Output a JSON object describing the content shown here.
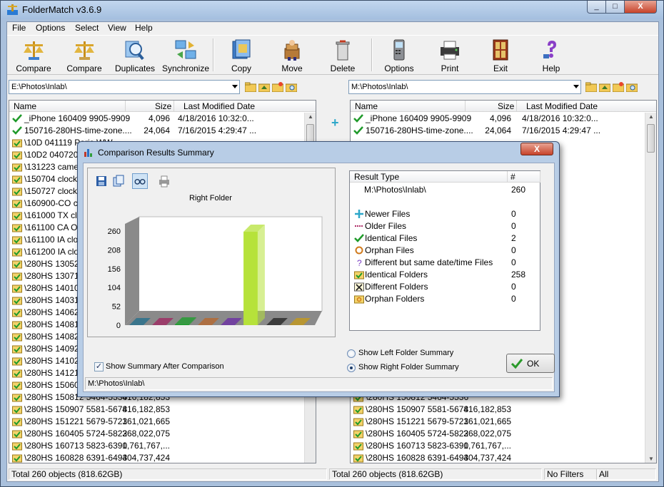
{
  "window": {
    "title": "FolderMatch v3.6.9",
    "min": "_",
    "max": "□",
    "close": "X"
  },
  "menu": [
    "File",
    "Options",
    "Select",
    "View",
    "Help"
  ],
  "toolbar": [
    {
      "label": "Compare",
      "icon": "compare-icon"
    },
    {
      "label": "Compare",
      "icon": "compare-scales-icon"
    },
    {
      "label": "Duplicates",
      "icon": "duplicates-icon"
    },
    {
      "label": "Synchronize",
      "icon": "synchronize-icon"
    },
    {
      "label": "Copy",
      "icon": "copy-icon"
    },
    {
      "label": "Move",
      "icon": "move-icon"
    },
    {
      "label": "Delete",
      "icon": "delete-icon"
    },
    {
      "label": "Options",
      "icon": "options-icon"
    },
    {
      "label": "Print",
      "icon": "print-icon"
    },
    {
      "label": "Exit",
      "icon": "exit-icon"
    },
    {
      "label": "Help",
      "icon": "help-icon"
    }
  ],
  "left": {
    "path": "E:\\Photos\\Inlab\\",
    "columns": [
      "Name",
      "Size",
      "Last Modified Date"
    ],
    "rows": [
      {
        "icon": "check",
        "name": "_iPhone 160409 9905-9909",
        "size": "4,096",
        "date": "4/18/2016 10:32:0..."
      },
      {
        "icon": "check",
        "name": "150716-280HS-time-zone....",
        "size": "24,064",
        "date": "7/16/2015 4:29:47 ..."
      },
      {
        "icon": "folder",
        "name": "\\10D 041119 Paris WW...",
        "size": "",
        "date": ""
      },
      {
        "icon": "folder",
        "name": "\\10D2 040720",
        "size": "",
        "date": ""
      },
      {
        "icon": "folder",
        "name": "\\131223 camera",
        "size": "",
        "date": ""
      },
      {
        "icon": "folder",
        "name": "\\150704 clock",
        "size": "",
        "date": ""
      },
      {
        "icon": "folder",
        "name": "\\150727 clock",
        "size": "",
        "date": ""
      },
      {
        "icon": "folder",
        "name": "\\160900-CO clock",
        "size": "",
        "date": ""
      },
      {
        "icon": "folder",
        "name": "\\161000 TX clock",
        "size": "",
        "date": ""
      },
      {
        "icon": "folder",
        "name": "\\161100 CA OH",
        "size": "",
        "date": ""
      },
      {
        "icon": "folder",
        "name": "\\161100 IA clock",
        "size": "",
        "date": ""
      },
      {
        "icon": "folder",
        "name": "\\161200 IA clock",
        "size": "",
        "date": ""
      },
      {
        "icon": "folder",
        "name": "\\280HS 130520",
        "size": "",
        "date": ""
      },
      {
        "icon": "folder",
        "name": "\\280HS 130712",
        "size": "",
        "date": ""
      },
      {
        "icon": "folder",
        "name": "\\280HS 140102",
        "size": "",
        "date": ""
      },
      {
        "icon": "folder",
        "name": "\\280HS 140317",
        "size": "",
        "date": ""
      },
      {
        "icon": "folder",
        "name": "\\280HS 140625",
        "size": "",
        "date": ""
      },
      {
        "icon": "folder",
        "name": "\\280HS 140814",
        "size": "",
        "date": ""
      },
      {
        "icon": "folder",
        "name": "\\280HS 140827",
        "size": "",
        "date": ""
      },
      {
        "icon": "folder",
        "name": "\\280HS 140925",
        "size": "",
        "date": ""
      },
      {
        "icon": "folder",
        "name": "\\280HS 141023",
        "size": "",
        "date": ""
      },
      {
        "icon": "folder",
        "name": "\\280HS 141210",
        "size": "",
        "date": ""
      },
      {
        "icon": "folder",
        "name": "\\280HS 150601",
        "size": "",
        "date": ""
      },
      {
        "icon": "folder",
        "name": "\\280HS 150812 5464-5536",
        "size": "416,182,853",
        "date": ""
      },
      {
        "icon": "folder",
        "name": "\\280HS 150907 5581-5678",
        "size": "416,182,853",
        "date": ""
      },
      {
        "icon": "folder",
        "name": "\\280HS 151221 5679-5723",
        "size": "161,021,665",
        "date": ""
      },
      {
        "icon": "folder",
        "name": "\\280HS 160405 5724-5822",
        "size": "368,022,075",
        "date": ""
      },
      {
        "icon": "folder",
        "name": "\\280HS 160713 5823-6390",
        "size": "1,761,767,...",
        "date": ""
      },
      {
        "icon": "folder",
        "name": "\\280HS 160828 6391-6493",
        "size": "404,737,424",
        "date": ""
      }
    ]
  },
  "right": {
    "path": "M:\\Photos\\Inlab\\",
    "columns": [
      "Name",
      "Size",
      "Last Modified Date"
    ],
    "rows": [
      {
        "icon": "check",
        "name": "_iPhone 160409 9905-9909",
        "size": "4,096",
        "date": "4/18/2016 10:32:0..."
      },
      {
        "icon": "check",
        "name": "150716-280HS-time-zone....",
        "size": "24,064",
        "date": "7/16/2015 4:29:47 ..."
      },
      {
        "icon": "folder",
        "name": "\\280HS 150812 5464-5536",
        "size": "",
        "date": ""
      },
      {
        "icon": "folder",
        "name": "\\280HS 150907 5581-5678",
        "size": "416,182,853",
        "date": ""
      },
      {
        "icon": "folder",
        "name": "\\280HS 151221 5679-5723",
        "size": "161,021,665",
        "date": ""
      },
      {
        "icon": "folder",
        "name": "\\280HS 160405 5724-5822",
        "size": "368,022,075",
        "date": ""
      },
      {
        "icon": "folder",
        "name": "\\280HS 160713 5823-6390",
        "size": "1,761,767,...",
        "date": ""
      },
      {
        "icon": "folder",
        "name": "\\280HS 160828 6391-6493",
        "size": "404,737,424",
        "date": ""
      }
    ]
  },
  "status": {
    "left": "Total 260 objects  (818.62GB)",
    "right": "Total 260 objects  (818.62GB)",
    "filters": "No Filters",
    "all": "All"
  },
  "dialog": {
    "title": "Comparison Results Summary",
    "close": "X",
    "chart_title": "Right Folder",
    "results_header": [
      "Result Type",
      "#"
    ],
    "results": [
      {
        "icon": "none",
        "label": "M:\\Photos\\Inlab\\",
        "value": "260"
      },
      {
        "icon": "none",
        "label": "",
        "value": ""
      },
      {
        "icon": "plus",
        "label": "Newer Files",
        "value": "0"
      },
      {
        "icon": "minus",
        "label": "Older Files",
        "value": "0"
      },
      {
        "icon": "check",
        "label": "Identical Files",
        "value": "2"
      },
      {
        "icon": "orphan",
        "label": "Orphan Files",
        "value": "0"
      },
      {
        "icon": "question",
        "label": "Different but same date/time Files",
        "value": "0"
      },
      {
        "icon": "folder-check",
        "label": "Identical Folders",
        "value": "258"
      },
      {
        "icon": "folder-x",
        "label": "Different Folders",
        "value": "0"
      },
      {
        "icon": "folder-orphan",
        "label": "Orphan Folders",
        "value": "0"
      }
    ],
    "radio_left": "Show Left Folder Summary",
    "radio_right": "Show Right Folder Summary",
    "checkbox": "Show Summary After Comparison",
    "ok": "OK",
    "status_path": "M:\\Photos\\Inlab\\"
  },
  "chart_data": {
    "type": "bar",
    "title": "Right Folder",
    "categories": [
      "Newer Files",
      "Older Files",
      "Identical Files",
      "Orphan Files",
      "Different but same date/time Files",
      "Identical Folders",
      "Different Folders",
      "Orphan Folders"
    ],
    "values": [
      0,
      0,
      2,
      0,
      0,
      258,
      0,
      0
    ],
    "colors": [
      "#1f6e8c",
      "#a0235f",
      "#1a9d2a",
      "#b8662a",
      "#6a2aa5",
      "#b6e23a",
      "#222222",
      "#c79a14"
    ],
    "yticks": [
      0,
      52,
      104,
      156,
      208,
      260
    ],
    "ylim": [
      0,
      260
    ],
    "grid": false
  }
}
